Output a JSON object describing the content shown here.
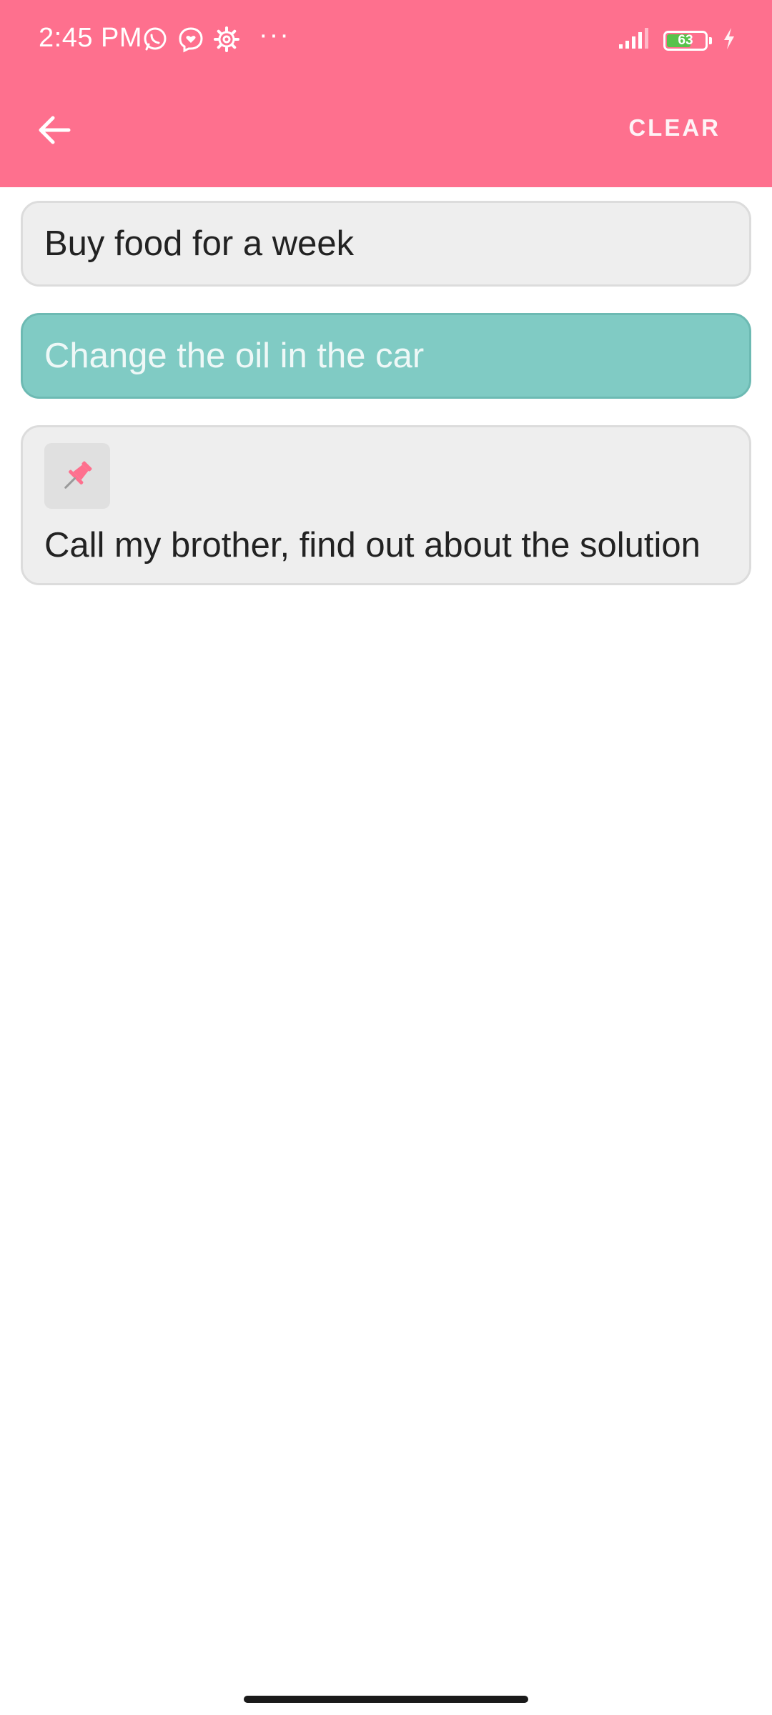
{
  "status_bar": {
    "time": "2:45 PM",
    "overflow": "···",
    "icons": [
      "whatsapp-icon",
      "messenger-icon",
      "settings-icon",
      "signal-icon",
      "battery-icon",
      "charging-icon"
    ],
    "battery_level": "63",
    "battery_color": "#57c24b"
  },
  "toolbar": {
    "background": "#fe708e",
    "back_icon": "arrow-left-icon",
    "clear_label": "CLEAR"
  },
  "tasks": [
    {
      "text": "Buy food for a week",
      "state": "normal"
    },
    {
      "text": "Change the oil in the car",
      "state": "done",
      "color": "#80cbc4"
    },
    {
      "text": "Call my brother, find out about the solution",
      "state": "pinned",
      "icon": "pin-icon"
    }
  ]
}
